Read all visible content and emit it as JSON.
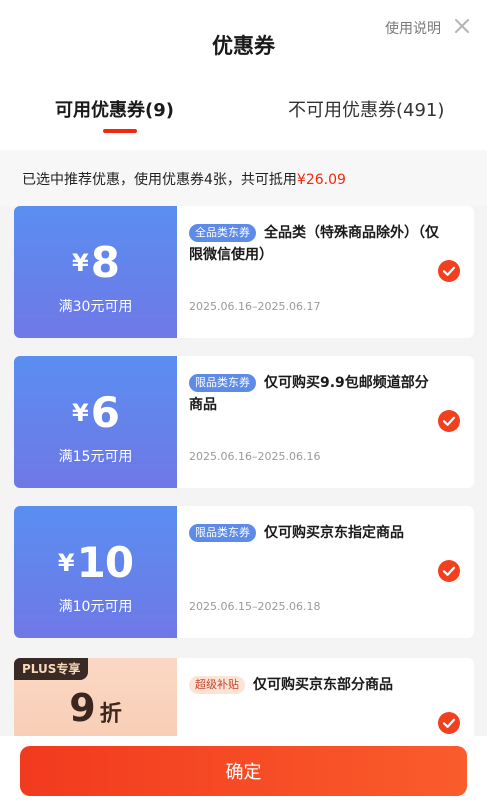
{
  "header": {
    "title": "优惠券",
    "help_label": "使用说明",
    "close_icon": "close-icon"
  },
  "tabs": [
    {
      "label": "可用优惠券(9)",
      "active": true
    },
    {
      "label": "不可用优惠券(491)",
      "active": false
    }
  ],
  "summary": {
    "text": "已选中推荐优惠，使用优惠券4张，共可抵用",
    "amount": "¥26.09"
  },
  "coupons": [
    {
      "currency": "¥",
      "value": "8",
      "threshold": "满30元可用",
      "tag": "全品类东券",
      "description": "全品类（特殊商品除外）（仅限微信使用）",
      "date": "2025.06.16–2025.06.17",
      "selected": true
    },
    {
      "currency": "¥",
      "value": "6",
      "threshold": "满15元可用",
      "tag": "限品类东券",
      "description": "仅可购买9.9包邮频道部分商品",
      "date": "2025.06.16–2025.06.16",
      "selected": true
    },
    {
      "currency": "¥",
      "value": "10",
      "threshold": "满10元可用",
      "tag": "限品类东券",
      "description": "仅可购买京东指定商品",
      "date": "2025.06.15–2025.06.18",
      "selected": true
    },
    {
      "badge": "PLUS专享",
      "discount_value": "9",
      "discount_unit": "折",
      "tag": "超级补贴",
      "description": "仅可购买京东部分商品",
      "selected": true
    }
  ],
  "footer": {
    "confirm_label": "确定"
  },
  "colors": {
    "accent": "#f2270c",
    "coupon_blue": "#5a8ef0",
    "plus_peach": "#fbd8c4"
  }
}
